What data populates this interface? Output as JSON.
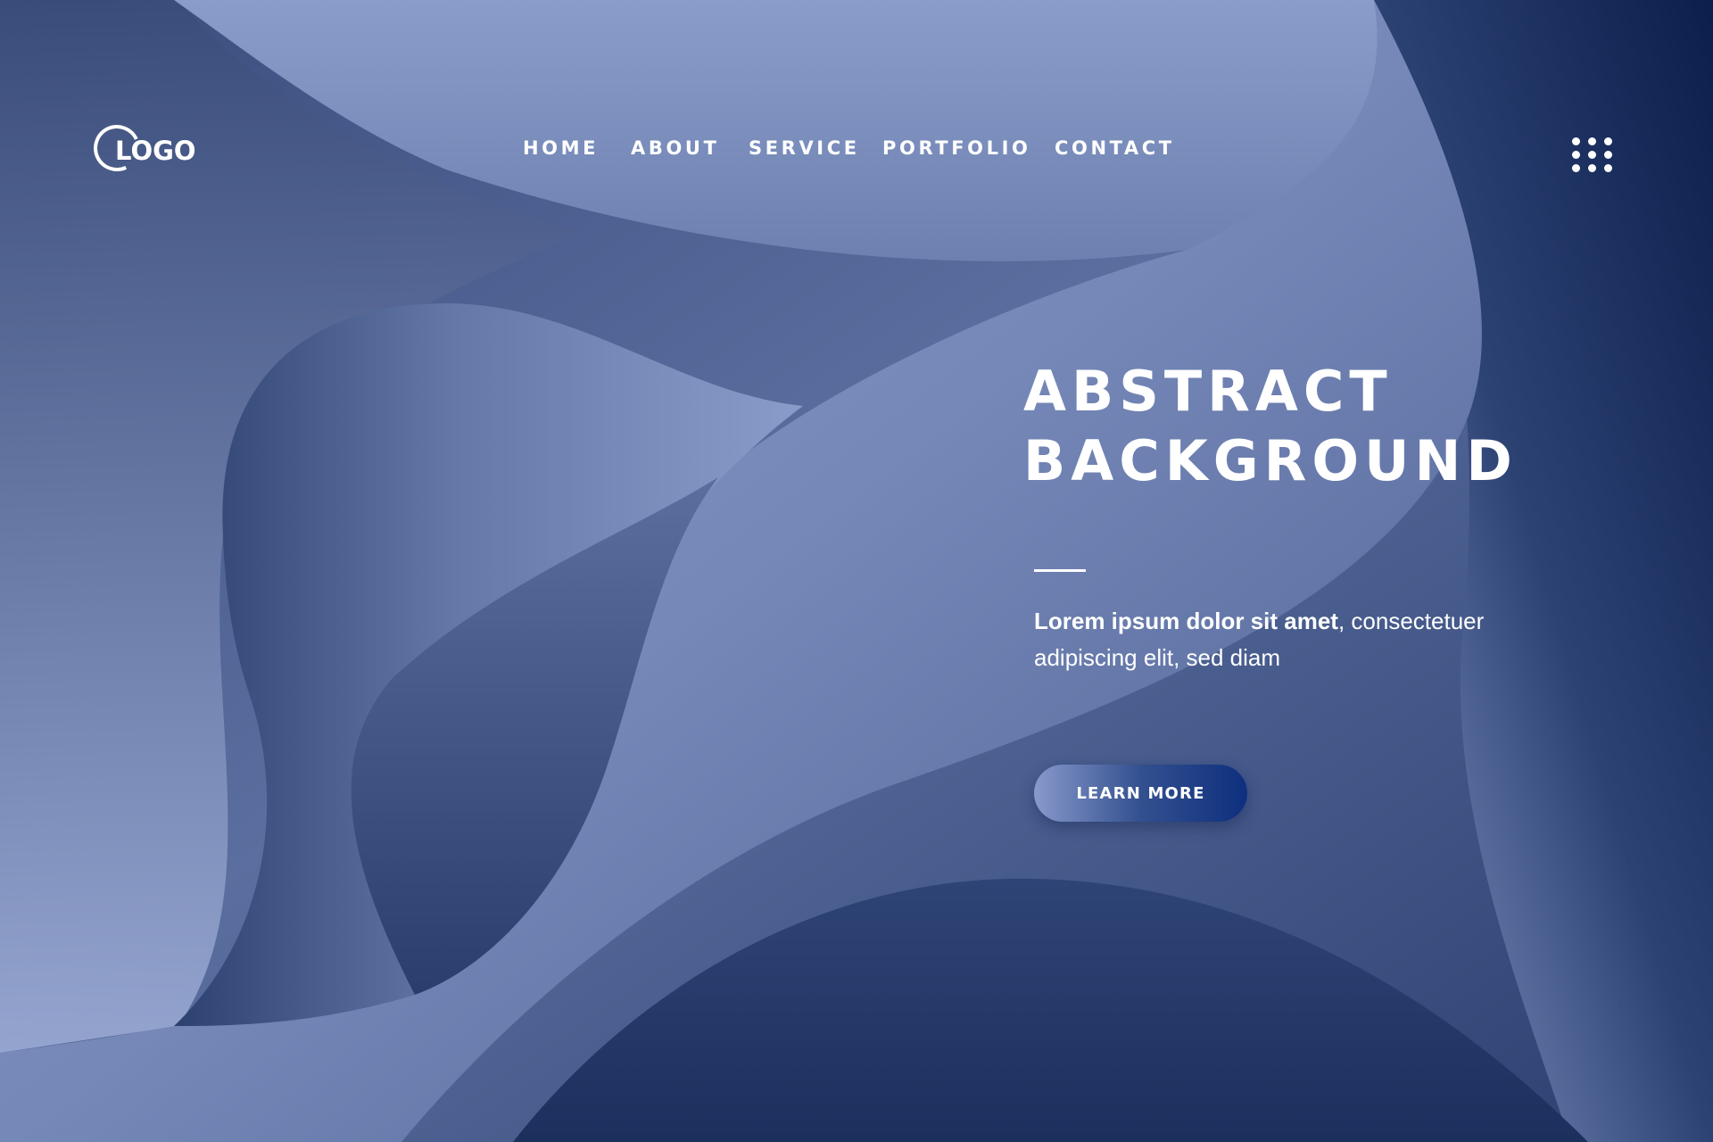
{
  "logo": {
    "text": "LOGO"
  },
  "nav": {
    "items": [
      {
        "label": "HOME"
      },
      {
        "label": "ABOUT"
      },
      {
        "label": "SERVICE"
      },
      {
        "label": "PORTFOLIO"
      },
      {
        "label": "CONTACT"
      }
    ]
  },
  "menu": {
    "icon": "grid-dots-icon"
  },
  "hero": {
    "title_line1": "ABSTRACT",
    "title_line2": "BACKGROUND",
    "desc_bold": "Lorem ipsum dolor sit amet",
    "desc_rest": ", consectetuer adipiscing elit, sed diam",
    "cta_label": "LEARN MORE"
  },
  "colors": {
    "dark_navy": "#1a2d5e",
    "mid_blue": "#5c6f9f",
    "light_blue": "#8fa2cf",
    "text": "#ffffff",
    "cta_end": "#0e2f7e"
  }
}
